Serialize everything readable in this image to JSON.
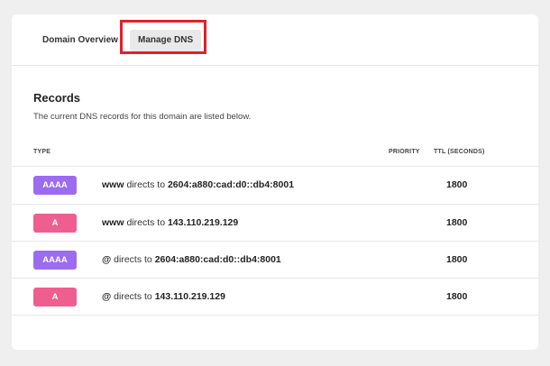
{
  "tabs": {
    "overview_label": "Domain Overview",
    "dns_label": "Manage DNS"
  },
  "records_section": {
    "title": "Records",
    "description": "The current DNS records for this domain are listed below."
  },
  "table_headers": {
    "type": "TYPE",
    "priority": "PRIORITY",
    "ttl": "TTL (SECONDS)"
  },
  "records": [
    {
      "type": "AAAA",
      "name": "www",
      "connector": "directs to",
      "value": "2604:a880:cad:d0::db4:8001",
      "ttl": "1800"
    },
    {
      "type": "A",
      "name": "www",
      "connector": "directs to",
      "value": "143.110.219.129",
      "ttl": "1800"
    },
    {
      "type": "AAAA",
      "name": "@",
      "connector": "directs to",
      "value": "2604:a880:cad:d0::db4:8001",
      "ttl": "1800"
    },
    {
      "type": "A",
      "name": "@",
      "connector": "directs to",
      "value": "143.110.219.129",
      "ttl": "1800"
    }
  ],
  "colors": {
    "aaaa_badge": "#9b6cf0",
    "a_badge": "#ee5f8f",
    "highlight": "#e0212b"
  }
}
